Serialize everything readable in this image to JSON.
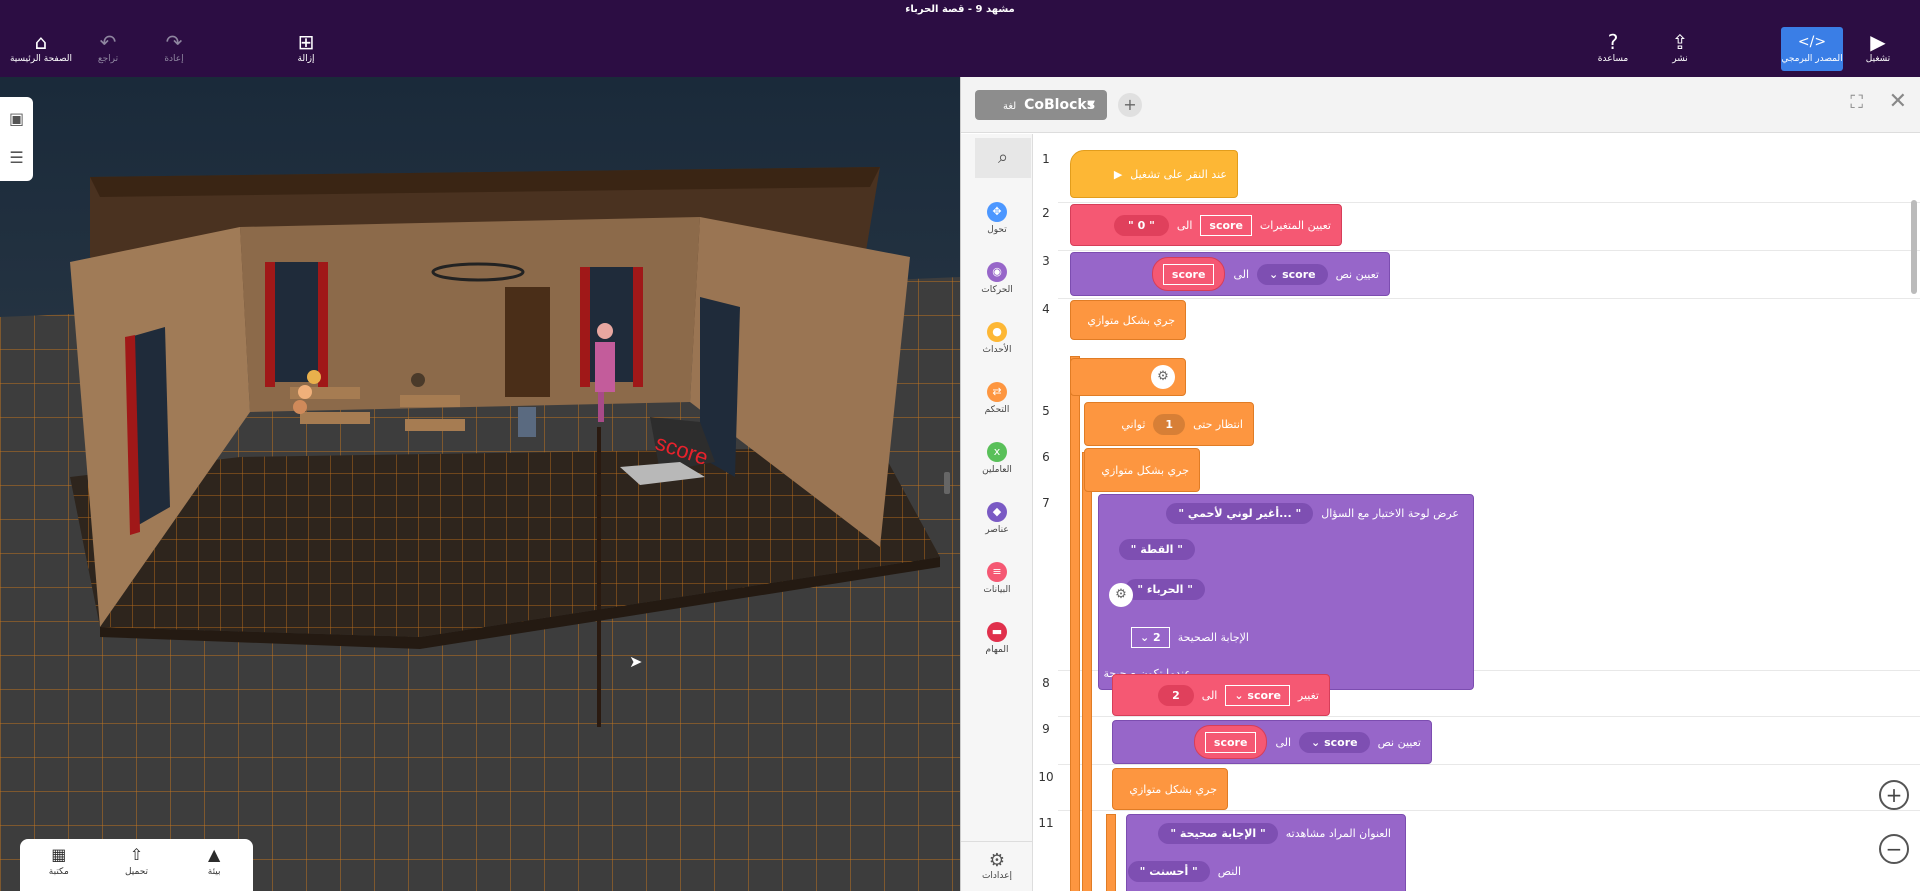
{
  "window": {
    "title": "مشهد 9 - قصة الحرباء"
  },
  "topbar": {
    "home": "الصفحة الرئيسية",
    "undo": "تراجع",
    "redo": "إعادة",
    "remove": "إزالة",
    "help": "مساعدة",
    "publish": "نشر",
    "source": "المصدر البرمجي",
    "run": "تشغيل"
  },
  "bottom_panel": {
    "library": "مكتبة",
    "upload": "تحميل",
    "environment": "بيئة"
  },
  "code_panel": {
    "language": "CoBlocks",
    "language_prefix": "لغة",
    "categories": [
      {
        "label": "تحول",
        "color": "#4c97ff"
      },
      {
        "label": "الحركات",
        "color": "#9766c9"
      },
      {
        "label": "الأحداث",
        "color": "#fdb735"
      },
      {
        "label": "التحكم",
        "color": "#fd9640"
      },
      {
        "label": "العاملين",
        "color": "#59c059"
      },
      {
        "label": "عناصر",
        "color": "#7a5ac4"
      },
      {
        "label": "البيانات",
        "color": "#f55873"
      },
      {
        "label": "المهام",
        "color": "#e0304c"
      }
    ],
    "settings": "إعدادات",
    "line_numbers": [
      "1",
      "2",
      "3",
      "4",
      "5",
      "6",
      "7",
      "8",
      "9",
      "10",
      "11"
    ]
  },
  "scene": {
    "screen_text": "score"
  },
  "blocks": {
    "b1": "عند النقر على تشغيل",
    "b2_label": "تعيين المتغيرات",
    "b2_var": "score",
    "b2_to": "الى",
    "b2_val": "\" 0 \"",
    "b3_label": "تعيين نص",
    "b3_var": "score",
    "b3_to": "الى",
    "b3_val": "score",
    "b4": "جري بشكل متوازي",
    "b5_label": "انتظار حتى",
    "b5_val": "1",
    "b5_unit": "ثواني",
    "b6": "جري بشكل متوازي",
    "b7_label": "عرض لوحة الاختيار مع السؤال",
    "b7_q": "\" ...أغير لوني لأحمي \"",
    "b7_opt1": "\" القطة \"",
    "b7_opt2": "\" الحرباء \"",
    "b7_correct_label": "الإجابة الصحيحة",
    "b7_correct_val": "2",
    "b7_when": "عندما تكون صحيحة",
    "b8_label": "تغيير",
    "b8_var": "score",
    "b8_to": "الى",
    "b8_val": "2",
    "b9_label": "تعيين نص",
    "b9_var": "score",
    "b9_to": "الى",
    "b9_val": "score",
    "b10": "جري بشكل متوازي",
    "b11_label": "العنوان المراد مشاهدته",
    "b11_val": "\" الإجابة صحيحة \"",
    "b11_text_label": "النص",
    "b11_text_val": "\" أحسنت \""
  }
}
